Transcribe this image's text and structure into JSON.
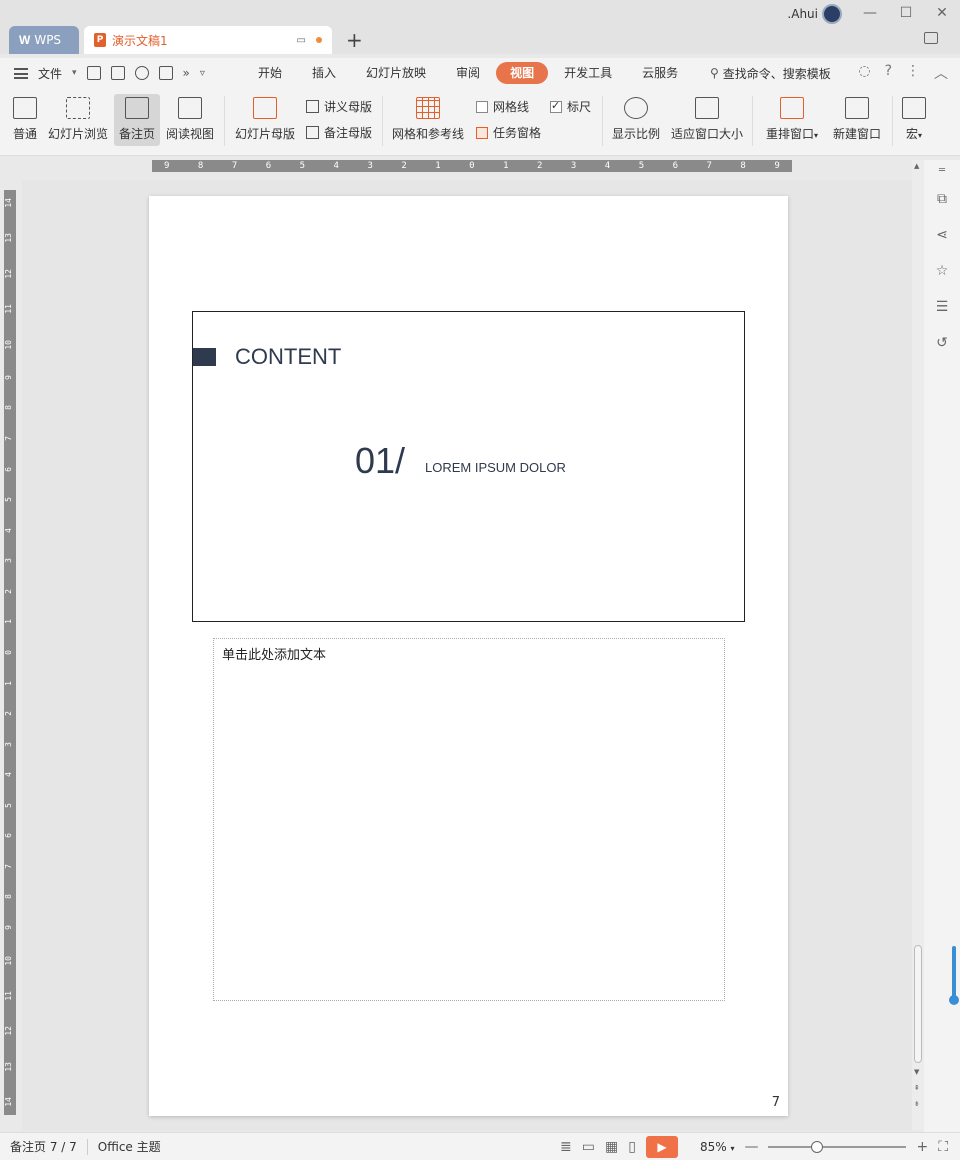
{
  "window": {
    "user_name": ".Ahui",
    "tabs": [
      {
        "label": "WPS",
        "icon": "wps-logo-icon"
      },
      {
        "label": "演示文稿1",
        "icon": "presentation-icon"
      }
    ],
    "new_tab": "+",
    "controls": [
      "minimize",
      "maximize",
      "close"
    ]
  },
  "menubar": {
    "file_label": "文件",
    "tabs": [
      "开始",
      "插入",
      "幻灯片放映",
      "审阅",
      "视图",
      "开发工具",
      "云服务"
    ],
    "active_tab": "视图",
    "search_label": "查找命令、搜索模板"
  },
  "ribbon": {
    "normal": "普通",
    "slide_browse": "幻灯片浏览",
    "notes_page": "备注页",
    "reading_view": "阅读视图",
    "slide_master": "幻灯片母版",
    "handout_master": "讲义母版",
    "notes_master": "备注母版",
    "grid_guides": "网格和参考线",
    "gridlines": {
      "label": "网格线",
      "checked": false
    },
    "ruler": {
      "label": "标尺",
      "checked": true
    },
    "task_pane": {
      "label": "任务窗格",
      "checked": true
    },
    "zoom": "显示比例",
    "fit_window": "适应窗口大小",
    "arrange_windows": "重排窗口",
    "new_window": "新建窗口",
    "macro": "宏"
  },
  "ruler": {
    "horizontal": [
      "9",
      "8",
      "7",
      "6",
      "5",
      "4",
      "3",
      "2",
      "1",
      "0",
      "1",
      "2",
      "3",
      "4",
      "5",
      "6",
      "7",
      "8",
      "9"
    ],
    "vertical": [
      "14",
      "13",
      "12",
      "11",
      "10",
      "9",
      "8",
      "7",
      "6",
      "5",
      "4",
      "3",
      "2",
      "1",
      "0",
      "1",
      "2",
      "3",
      "4",
      "5",
      "6",
      "7",
      "8",
      "9",
      "10",
      "11",
      "12",
      "13",
      "14"
    ]
  },
  "slide": {
    "title": "CONTENT",
    "number": "01/",
    "subtitle": "LOREM IPSUM DOLOR"
  },
  "notes": {
    "placeholder": "单击此处添加文本"
  },
  "page_number": "7",
  "statusbar": {
    "page_info": "备注页 7 / 7",
    "theme": "Office 主题",
    "zoom": "85%",
    "zoom_level": 0.85
  },
  "colors": {
    "accent": "#e7744a",
    "slide_dark": "#2f3a4e",
    "wps_tab": "#8b9fbe",
    "scroll_accent": "#3a8fd4"
  }
}
